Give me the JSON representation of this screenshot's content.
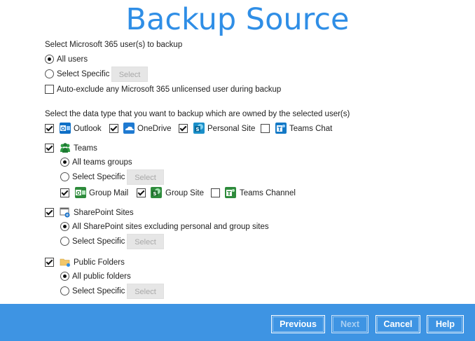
{
  "title": "Backup Source",
  "users": {
    "prompt": "Select Microsoft 365 user(s) to backup",
    "all_label": "All users",
    "specific_label": "Select Specific",
    "select_button": "Select",
    "auto_exclude_label": "Auto-exclude any Microsoft 365 unlicensed user during backup",
    "selected": "all",
    "auto_exclude_checked": false
  },
  "data_types": {
    "prompt": "Select the data type that you want to backup which are owned by the selected user(s)",
    "items": [
      {
        "label": "Outlook",
        "checked": true,
        "icon": "outlook-icon"
      },
      {
        "label": "OneDrive",
        "checked": true,
        "icon": "onedrive-icon"
      },
      {
        "label": "Personal Site",
        "checked": true,
        "icon": "sharepoint-icon"
      },
      {
        "label": "Teams Chat",
        "checked": false,
        "icon": "teams-icon"
      }
    ]
  },
  "teams": {
    "label": "Teams",
    "checked": true,
    "all_label": "All teams groups",
    "specific_label": "Select Specific",
    "select_button": "Select",
    "sub_items": [
      {
        "label": "Group Mail",
        "checked": true
      },
      {
        "label": "Group Site",
        "checked": true
      },
      {
        "label": "Teams Channel",
        "checked": false
      }
    ]
  },
  "sharepoint": {
    "label": "SharePoint Sites",
    "checked": true,
    "all_label": "All SharePoint sites excluding personal and group sites",
    "specific_label": "Select Specific",
    "select_button": "Select"
  },
  "public_folders": {
    "label": "Public Folders",
    "checked": true,
    "all_label": "All public folders",
    "specific_label": "Select Specific",
    "select_button": "Select"
  },
  "footer": {
    "previous": "Previous",
    "next": "Next",
    "cancel": "Cancel",
    "help": "Help"
  },
  "colors": {
    "accent": "#2f8ee6",
    "footer": "#3e94e3"
  }
}
